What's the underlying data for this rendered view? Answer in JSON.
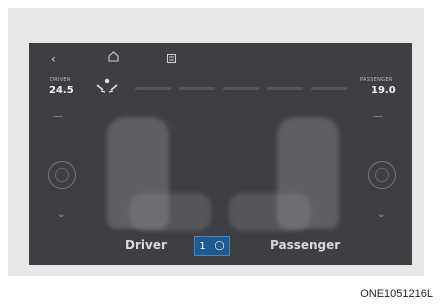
{
  "icons": {
    "back": "back-arrow-icon",
    "home": "home-icon",
    "menu": "menu-icon",
    "airflow": "airflow-icon",
    "chevron_up": "chevron-up-icon",
    "chevron_down": "chevron-down-icon",
    "seat_vent": "seat-vent-icon",
    "sync": "sync-icon"
  },
  "driver": {
    "temp_label": "DRIVER",
    "temp": "24.5",
    "label": "Driver"
  },
  "passenger": {
    "temp_label": "PASSENGER",
    "temp": "19.0",
    "label": "Passenger"
  },
  "sync": {
    "text": "1"
  },
  "caption": "ONE1051216L",
  "colors": {
    "screen_bg": "#3e3f43",
    "sync_bg": "#1e5a8e",
    "outer_bg": "#e7e7e7"
  }
}
